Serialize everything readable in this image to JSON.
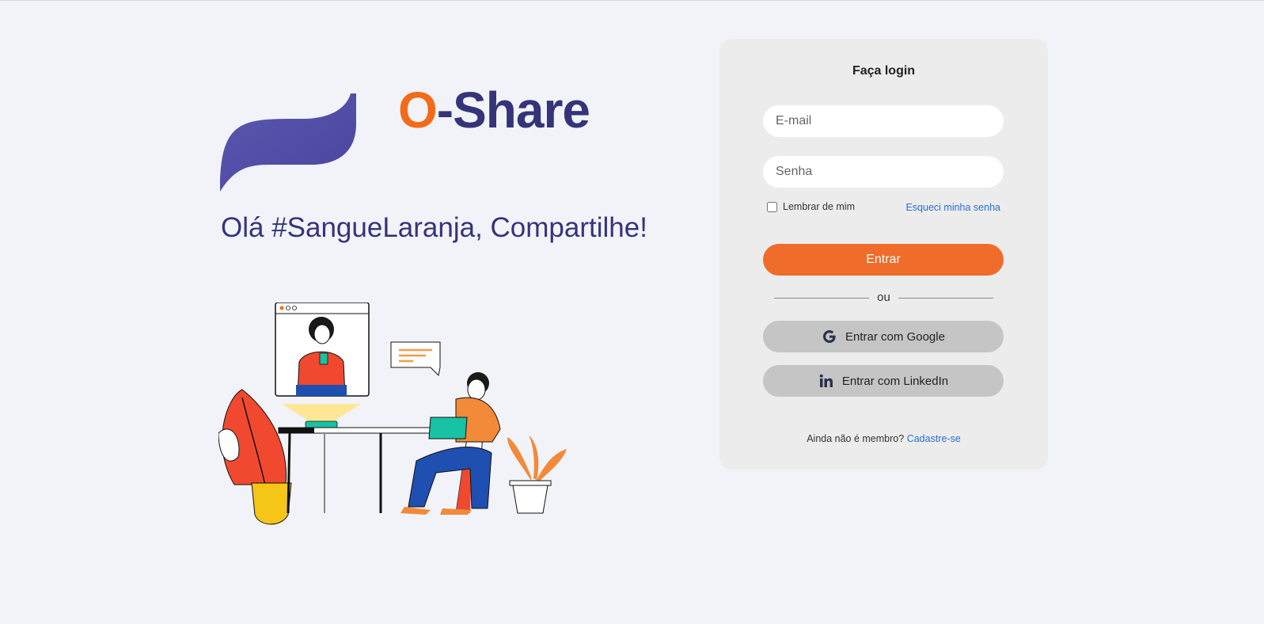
{
  "brand": {
    "prefix": "O",
    "suffix": "-Share",
    "accent_color": "#f46a16",
    "primary_color": "#35347a"
  },
  "hero": {
    "tagline": "Olá #SangueLaranja, Compartilhe!"
  },
  "login": {
    "title": "Faça login",
    "email_placeholder": "E-mail",
    "password_placeholder": "Senha",
    "remember_label": "Lembrar de mim",
    "forgot_link": "Esqueci minha senha",
    "submit_label": "Entrar",
    "divider_text": "ou",
    "google_label": "Entrar com Google",
    "linkedin_label": "Entrar com LinkedIn",
    "signup_prompt": "Ainda não é membro?",
    "signup_link": "Cadastre-se",
    "button_color": "#ef6c2a",
    "link_color": "#2a6fd6"
  },
  "icons": {
    "google": "google-icon",
    "linkedin": "linkedin-icon"
  }
}
